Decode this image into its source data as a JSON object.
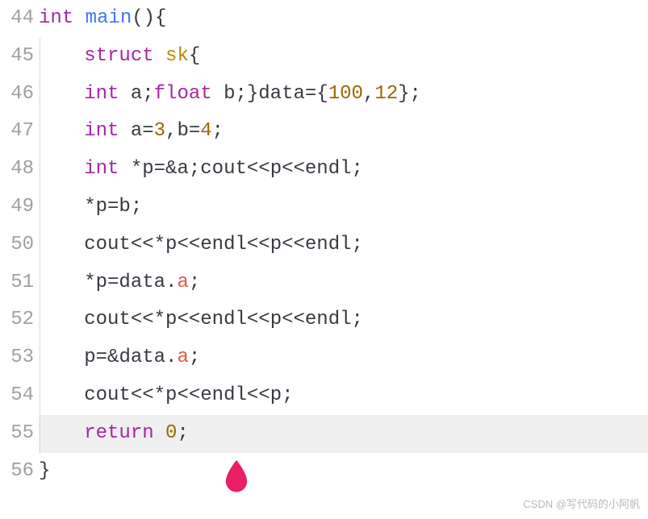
{
  "lines": [
    {
      "num": "44",
      "hl": false,
      "indent": false,
      "tokens": [
        {
          "t": "int ",
          "c": "ty"
        },
        {
          "t": "main",
          "c": "fn"
        },
        {
          "t": "(){",
          "c": "pun"
        }
      ]
    },
    {
      "num": "45",
      "hl": false,
      "indent": true,
      "tokens": [
        {
          "t": "   ",
          "c": ""
        },
        {
          "t": "struct ",
          "c": "kw"
        },
        {
          "t": "sk",
          "c": "cls"
        },
        {
          "t": "{",
          "c": "pun"
        }
      ]
    },
    {
      "num": "46",
      "hl": false,
      "indent": true,
      "tokens": [
        {
          "t": "   ",
          "c": ""
        },
        {
          "t": "int ",
          "c": "ty"
        },
        {
          "t": "a",
          "c": "id"
        },
        {
          "t": ";",
          "c": "pun"
        },
        {
          "t": "float ",
          "c": "ty"
        },
        {
          "t": "b",
          "c": "id"
        },
        {
          "t": ";}",
          "c": "pun"
        },
        {
          "t": "data",
          "c": "id"
        },
        {
          "t": "={",
          "c": "pun"
        },
        {
          "t": "100",
          "c": "num"
        },
        {
          "t": ",",
          "c": "pun"
        },
        {
          "t": "12",
          "c": "num"
        },
        {
          "t": "};",
          "c": "pun"
        }
      ]
    },
    {
      "num": "47",
      "hl": false,
      "indent": true,
      "tokens": [
        {
          "t": "   ",
          "c": ""
        },
        {
          "t": "int ",
          "c": "ty"
        },
        {
          "t": "a",
          "c": "id"
        },
        {
          "t": "=",
          "c": "op"
        },
        {
          "t": "3",
          "c": "num"
        },
        {
          "t": ",",
          "c": "pun"
        },
        {
          "t": "b",
          "c": "id"
        },
        {
          "t": "=",
          "c": "op"
        },
        {
          "t": "4",
          "c": "num"
        },
        {
          "t": ";",
          "c": "pun"
        }
      ]
    },
    {
      "num": "48",
      "hl": false,
      "indent": true,
      "tokens": [
        {
          "t": "   ",
          "c": ""
        },
        {
          "t": "int ",
          "c": "ty"
        },
        {
          "t": "*",
          "c": "op"
        },
        {
          "t": "p",
          "c": "id"
        },
        {
          "t": "=&",
          "c": "op"
        },
        {
          "t": "a",
          "c": "id"
        },
        {
          "t": ";",
          "c": "pun"
        },
        {
          "t": "cout",
          "c": "id"
        },
        {
          "t": "<<",
          "c": "op"
        },
        {
          "t": "p",
          "c": "id"
        },
        {
          "t": "<<",
          "c": "op"
        },
        {
          "t": "endl",
          "c": "id"
        },
        {
          "t": ";",
          "c": "pun"
        }
      ]
    },
    {
      "num": "49",
      "hl": false,
      "indent": true,
      "tokens": [
        {
          "t": "   *",
          "c": "op"
        },
        {
          "t": "p",
          "c": "id"
        },
        {
          "t": "=",
          "c": "op"
        },
        {
          "t": "b",
          "c": "id"
        },
        {
          "t": ";",
          "c": "pun"
        }
      ]
    },
    {
      "num": "50",
      "hl": false,
      "indent": true,
      "tokens": [
        {
          "t": "   ",
          "c": ""
        },
        {
          "t": "cout",
          "c": "id"
        },
        {
          "t": "<<*",
          "c": "op"
        },
        {
          "t": "p",
          "c": "id"
        },
        {
          "t": "<<",
          "c": "op"
        },
        {
          "t": "endl",
          "c": "id"
        },
        {
          "t": "<<",
          "c": "op"
        },
        {
          "t": "p",
          "c": "id"
        },
        {
          "t": "<<",
          "c": "op"
        },
        {
          "t": "endl",
          "c": "id"
        },
        {
          "t": ";",
          "c": "pun"
        }
      ]
    },
    {
      "num": "51",
      "hl": false,
      "indent": true,
      "tokens": [
        {
          "t": "   *",
          "c": "op"
        },
        {
          "t": "p",
          "c": "id"
        },
        {
          "t": "=",
          "c": "op"
        },
        {
          "t": "data",
          "c": "id"
        },
        {
          "t": ".",
          "c": "pun"
        },
        {
          "t": "a",
          "c": "prop"
        },
        {
          "t": ";",
          "c": "pun"
        }
      ]
    },
    {
      "num": "52",
      "hl": false,
      "indent": true,
      "tokens": [
        {
          "t": "   ",
          "c": ""
        },
        {
          "t": "cout",
          "c": "id"
        },
        {
          "t": "<<*",
          "c": "op"
        },
        {
          "t": "p",
          "c": "id"
        },
        {
          "t": "<<",
          "c": "op"
        },
        {
          "t": "endl",
          "c": "id"
        },
        {
          "t": "<<",
          "c": "op"
        },
        {
          "t": "p",
          "c": "id"
        },
        {
          "t": "<<",
          "c": "op"
        },
        {
          "t": "endl",
          "c": "id"
        },
        {
          "t": ";",
          "c": "pun"
        }
      ]
    },
    {
      "num": "53",
      "hl": false,
      "indent": true,
      "tokens": [
        {
          "t": "   ",
          "c": ""
        },
        {
          "t": "p",
          "c": "id"
        },
        {
          "t": "=&",
          "c": "op"
        },
        {
          "t": "data",
          "c": "id"
        },
        {
          "t": ".",
          "c": "pun"
        },
        {
          "t": "a",
          "c": "prop"
        },
        {
          "t": ";",
          "c": "pun"
        }
      ]
    },
    {
      "num": "54",
      "hl": false,
      "indent": true,
      "tokens": [
        {
          "t": "   ",
          "c": ""
        },
        {
          "t": "cout",
          "c": "id"
        },
        {
          "t": "<<*",
          "c": "op"
        },
        {
          "t": "p",
          "c": "id"
        },
        {
          "t": "<<",
          "c": "op"
        },
        {
          "t": "endl",
          "c": "id"
        },
        {
          "t": "<<",
          "c": "op"
        },
        {
          "t": "p",
          "c": "id"
        },
        {
          "t": ";",
          "c": "pun"
        }
      ]
    },
    {
      "num": "55",
      "hl": true,
      "indent": true,
      "tokens": [
        {
          "t": "   ",
          "c": ""
        },
        {
          "t": "return ",
          "c": "kw"
        },
        {
          "t": "0",
          "c": "num"
        },
        {
          "t": ";",
          "c": "pun"
        }
      ]
    },
    {
      "num": "56",
      "hl": false,
      "indent": false,
      "tokens": [
        {
          "t": "}",
          "c": "pun"
        }
      ]
    }
  ],
  "watermark": "CSDN @写代码的小阿帆",
  "cursor_color": "#e91e63"
}
